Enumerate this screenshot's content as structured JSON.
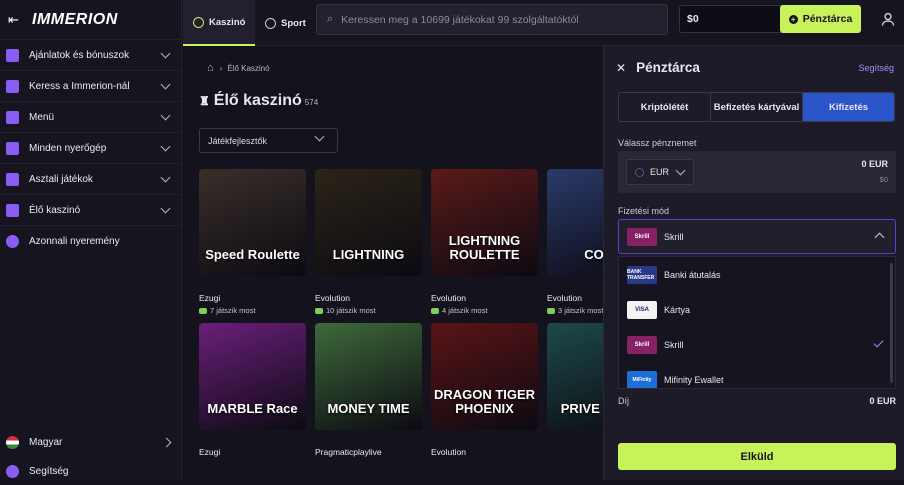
{
  "brand": {
    "logo": "IMMERION",
    "accent": "#c8f25a",
    "purple": "#8a5cf6"
  },
  "sidebar": {
    "items": [
      {
        "label": "Ajánlatok és bónuszok",
        "icon": "gift-icon"
      },
      {
        "label": "Keress a Immerion-nál",
        "icon": "coins-icon"
      },
      {
        "label": "Menü",
        "icon": "menu-icon"
      },
      {
        "label": "Minden nyerőgép",
        "icon": "grid-icon"
      },
      {
        "label": "Asztali játékok",
        "icon": "dice-icon"
      },
      {
        "label": "Élő kaszinó",
        "icon": "play-icon"
      },
      {
        "label": "Azonnali nyeremény",
        "icon": "star-icon"
      }
    ],
    "language": "Magyar",
    "help": "Segítség"
  },
  "topbar": {
    "tabs": [
      "Kaszinó",
      "Sport"
    ],
    "search_placeholder": "Keressen meg a 10699 játékokat 99 szolgáltatóktól",
    "balance": "$0",
    "cashier": "Pénztárca"
  },
  "main": {
    "breadcrumb": "Élő Kaszinó",
    "title": "Élő kaszinó",
    "count": "574",
    "provider_filter": "Játékfejlesztők",
    "games": [
      {
        "provider": "Ezugi",
        "players": "7 játszik most",
        "title": "Speed Roulette",
        "bg": "#3a2f2a"
      },
      {
        "provider": "Evolution",
        "players": "10 játszik most",
        "title": "LIGHTNING",
        "bg": "#2b2418"
      },
      {
        "provider": "Evolution",
        "players": "4 játszik most",
        "title": "LIGHTNING ROULETTE",
        "bg": "#5a1a18"
      },
      {
        "provider": "Evolution",
        "players": "3 játszik most",
        "title": "COIN",
        "bg": "#2a3a6a"
      },
      {
        "provider": "Ezugi",
        "players": "",
        "title": "MARBLE Race",
        "bg": "#6a1f7a"
      },
      {
        "provider": "Pragmaticplaylive",
        "players": "",
        "title": "MONEY TIME",
        "bg": "#3e6a3a"
      },
      {
        "provider": "Evolution",
        "players": "",
        "title": "DRAGON TIGER PHOENIX",
        "bg": "#5a1416"
      },
      {
        "provider": "",
        "players": "",
        "title": "PRIVE ROUL",
        "bg": "#1d4a4a"
      }
    ]
  },
  "wallet": {
    "title": "Pénztárca",
    "help": "Segítség",
    "tabs": [
      "Kriptólétét",
      "Befizetés kártyával",
      "Kifizetés"
    ],
    "currency_label": "Válassz pénznemet",
    "currency": "EUR",
    "amount": "0 EUR",
    "amount_usd": "$0",
    "method_label": "Fizetési mód",
    "selected_method": "Skrill",
    "methods": [
      {
        "name": "Banki átutalás",
        "logo": "BANK TRANSFER",
        "color": "#2a3a8a"
      },
      {
        "name": "Kártya",
        "logo": "VISA",
        "color": "#f4f4f4"
      },
      {
        "name": "Skrill",
        "logo": "Skrill",
        "color": "#862165"
      },
      {
        "name": "Mifinity Ewallet",
        "logo": "MiFinity",
        "color": "#1d6fd8"
      }
    ],
    "fee_label": "Díj",
    "fee_value": "0 EUR",
    "submit": "Elküld"
  }
}
